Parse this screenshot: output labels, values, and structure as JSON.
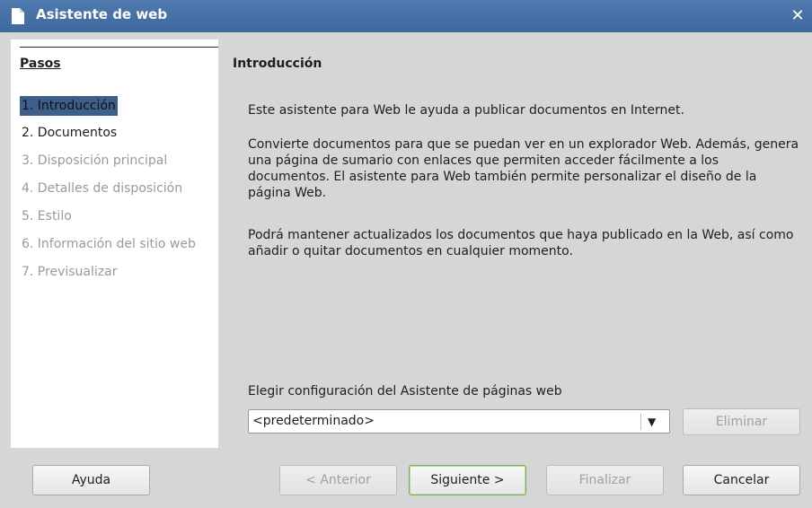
{
  "window": {
    "title": "Asistente de web"
  },
  "sidebar": {
    "title": "Pasos",
    "steps": [
      {
        "label": "1. Introducción",
        "state": "active"
      },
      {
        "label": "2. Documentos",
        "state": "enabled"
      },
      {
        "label": "3. Disposición principal",
        "state": "disabled"
      },
      {
        "label": "4. Detalles de disposición",
        "state": "disabled"
      },
      {
        "label": "5. Estilo",
        "state": "disabled"
      },
      {
        "label": "6. Información del sitio web",
        "state": "disabled"
      },
      {
        "label": "7. Previsualizar",
        "state": "disabled"
      }
    ]
  },
  "main": {
    "title": "Introducción",
    "paragraphs": [
      "Este asistente para Web le ayuda a publicar documentos en Internet.",
      "Convierte documentos para que se puedan ver en un explorador Web. Además, genera una página de sumario con enlaces que permiten acceder fácilmente a los documentos. El asistente para Web también permite personalizar el diseño de la página Web.",
      "Podrá mantener actualizados los documentos que haya publicado en la Web, así como añadir o quitar documentos en cualquier momento."
    ],
    "config_label": "Elegir configuración del Asistente de páginas web",
    "config_value": "<predeterminado>",
    "delete_button": "Eliminar"
  },
  "footer": {
    "help": "Ayuda",
    "previous": "< Anterior",
    "next": "Siguiente >",
    "finish": "Finalizar",
    "cancel": "Cancelar"
  },
  "colors": {
    "titlebar": "#4a74a9",
    "active_step": "#3e5f8a",
    "default_button_border": "#7cae57"
  },
  "icons": {
    "title": "document-icon",
    "close": "close-icon",
    "dropdown": "chevron-down-icon"
  }
}
